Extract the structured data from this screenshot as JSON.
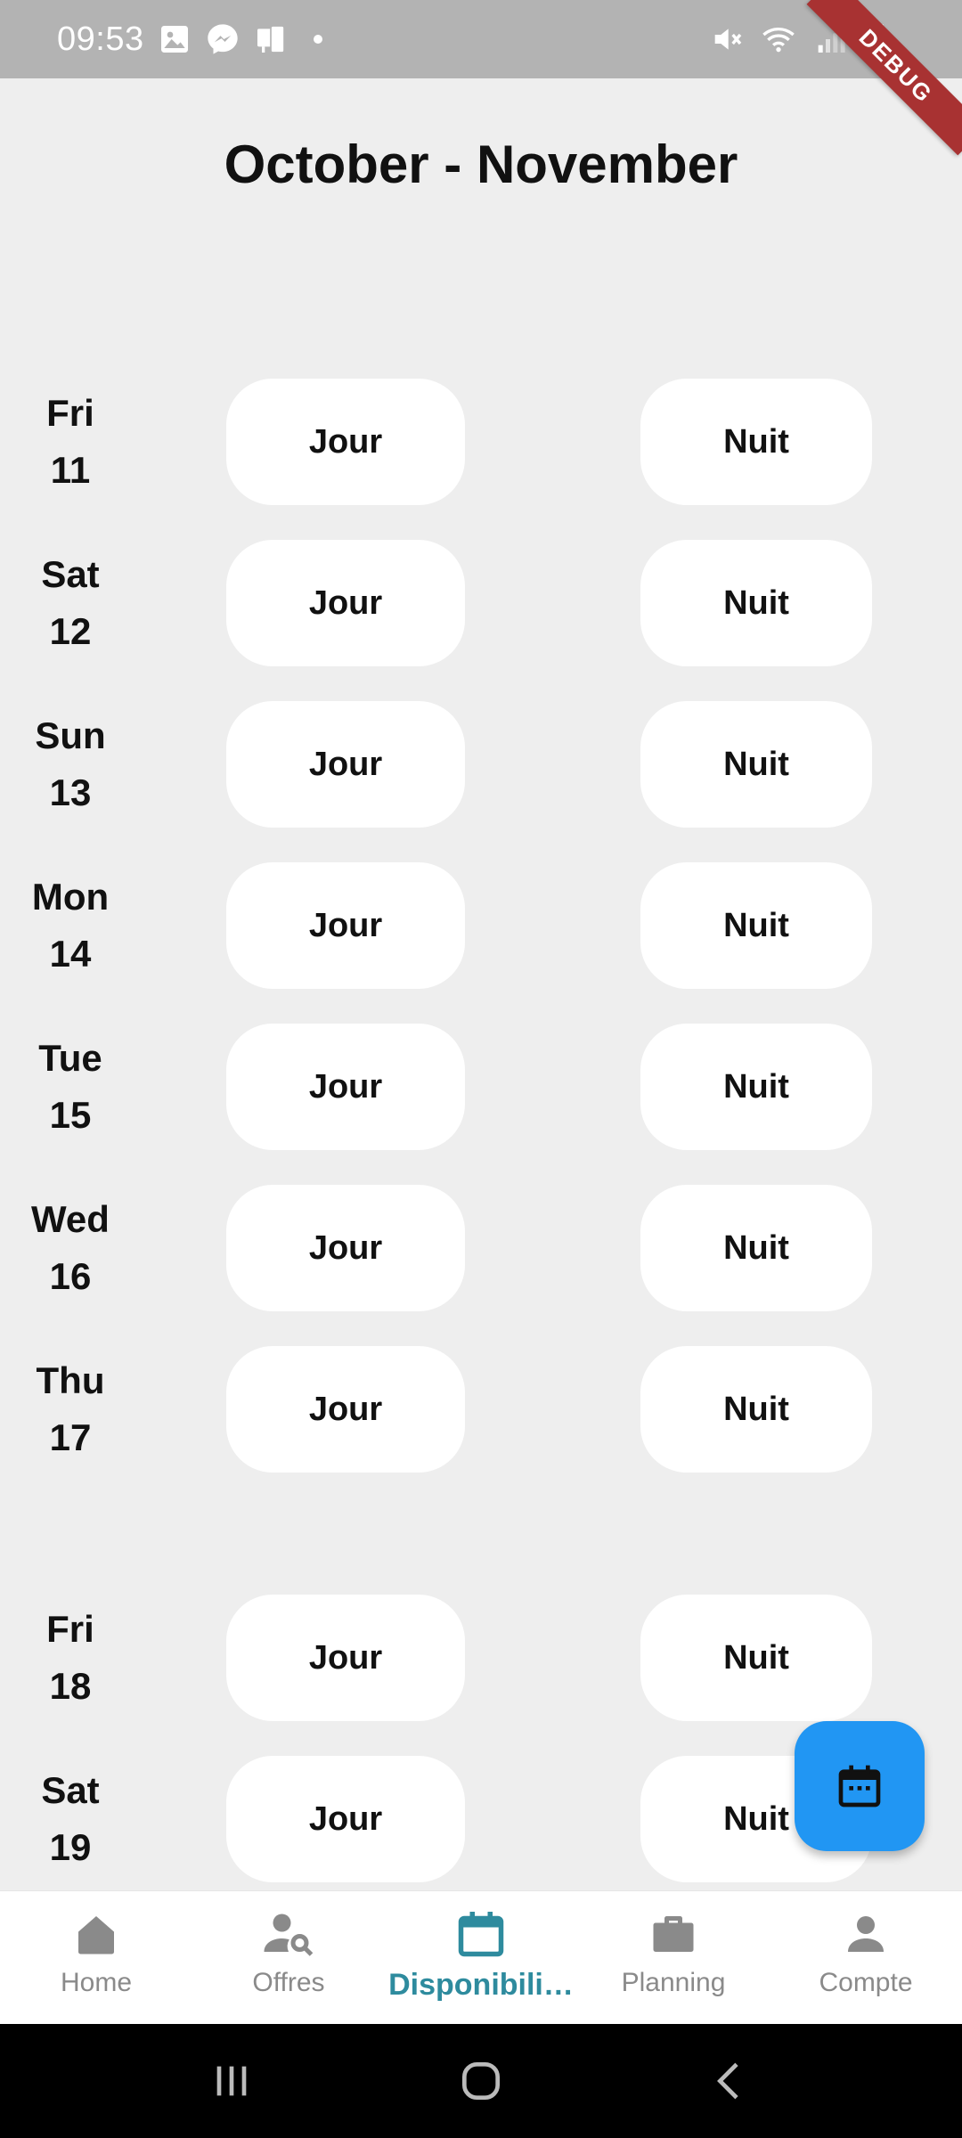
{
  "status_bar": {
    "time": "09:53",
    "left_icons": [
      "image-icon",
      "messenger-icon",
      "device-icon"
    ],
    "right_icons": [
      "mute-icon",
      "wifi-icon",
      "signal-icon",
      "battery-icon"
    ]
  },
  "debug_banner": "DEBUG",
  "title": "October - November",
  "days": [
    {
      "weekday": "Fri",
      "date": "11",
      "jour": "Jour",
      "nuit": "Nuit"
    },
    {
      "weekday": "Sat",
      "date": "12",
      "jour": "Jour",
      "nuit": "Nuit"
    },
    {
      "weekday": "Sun",
      "date": "13",
      "jour": "Jour",
      "nuit": "Nuit"
    },
    {
      "weekday": "Mon",
      "date": "14",
      "jour": "Jour",
      "nuit": "Nuit"
    },
    {
      "weekday": "Tue",
      "date": "15",
      "jour": "Jour",
      "nuit": "Nuit"
    },
    {
      "weekday": "Wed",
      "date": "16",
      "jour": "Jour",
      "nuit": "Nuit"
    },
    {
      "weekday": "Thu",
      "date": "17",
      "jour": "Jour",
      "nuit": "Nuit"
    },
    {
      "weekday": "Fri",
      "date": "18",
      "jour": "Jour",
      "nuit": "Nuit"
    },
    {
      "weekday": "Sat",
      "date": "19",
      "jour": "Jour",
      "nuit": "Nuit"
    }
  ],
  "fab_icon": "calendar-icon",
  "bottom_nav": [
    {
      "label": "Home",
      "icon": "home-icon",
      "active": false
    },
    {
      "label": "Offres",
      "icon": "person-search-icon",
      "active": false
    },
    {
      "label": "Disponibili…",
      "icon": "calendar-icon",
      "active": true
    },
    {
      "label": "Planning",
      "icon": "briefcase-icon",
      "active": false
    },
    {
      "label": "Compte",
      "icon": "person-icon",
      "active": false
    }
  ],
  "colors": {
    "accent": "#2e8b9e",
    "fab": "#2196f3",
    "background": "#eeeeee",
    "status_bar": "#b3b3b3",
    "debug": "#a83232"
  }
}
